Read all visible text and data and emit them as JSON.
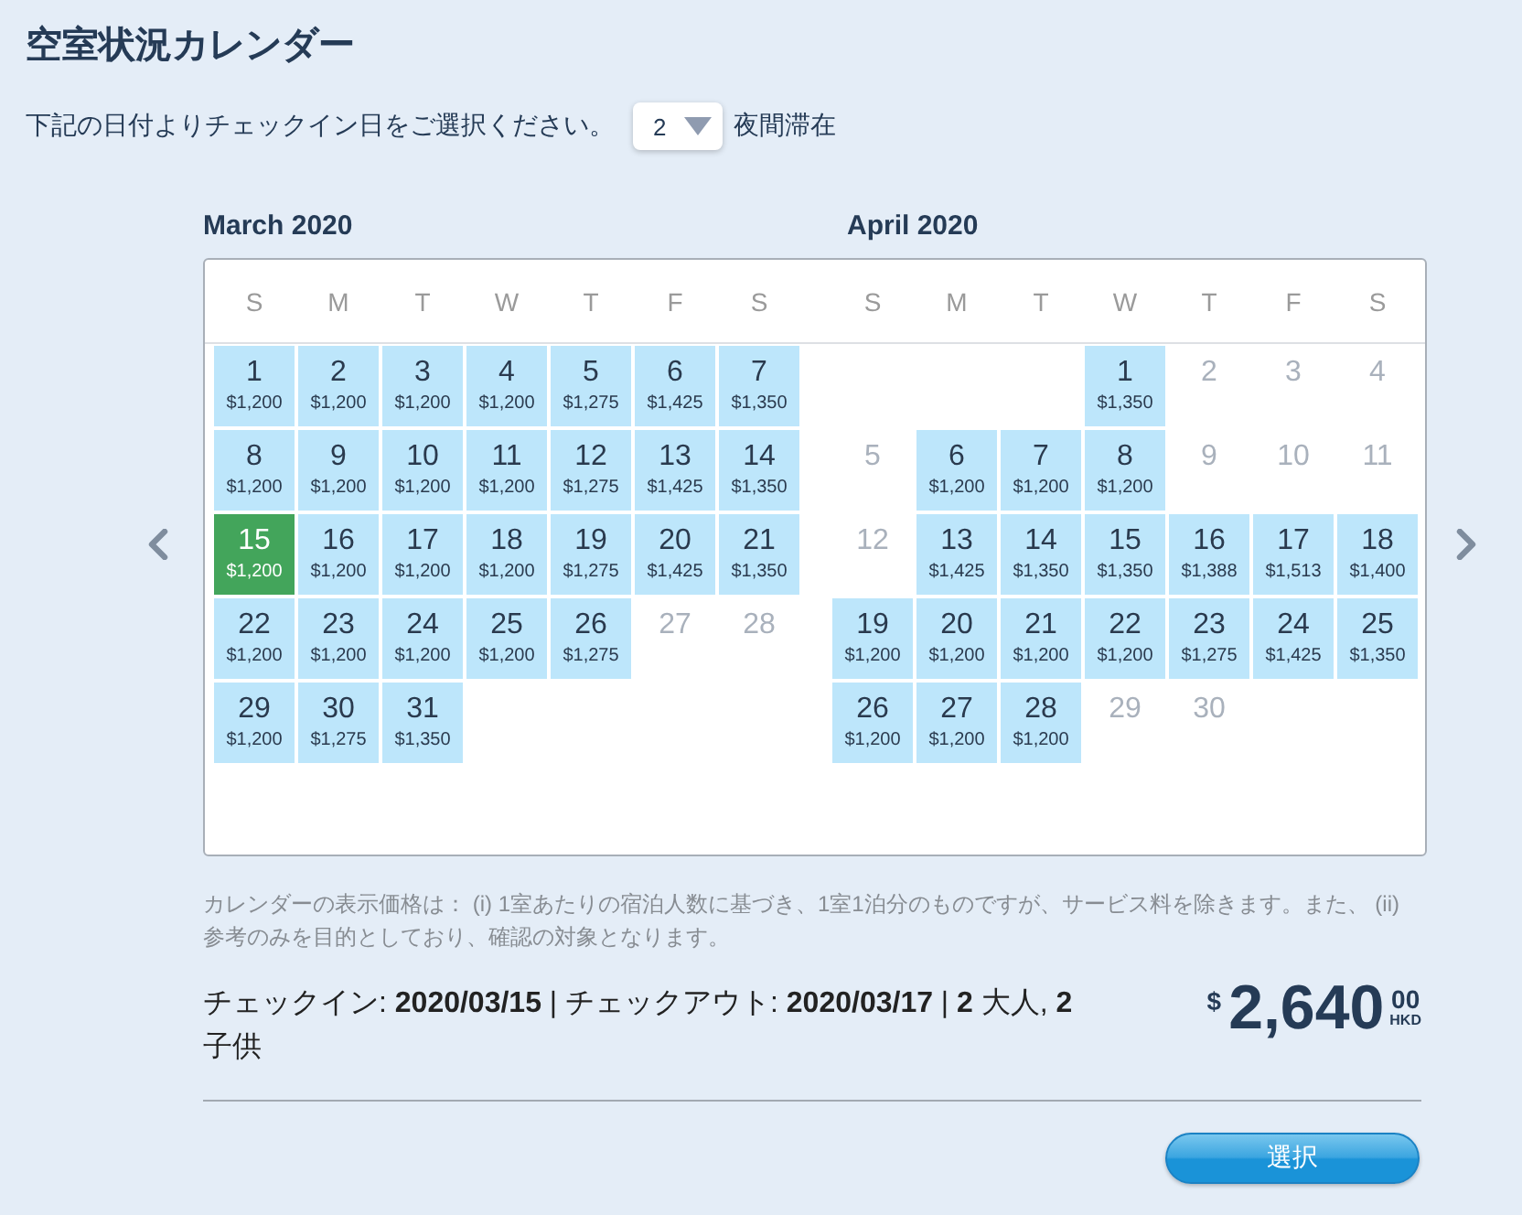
{
  "title": "空室状況カレンダー",
  "prompt": {
    "text": "下記の日付よりチェックイン日をご選択ください。",
    "nights_select": {
      "value": "2"
    },
    "suffix": "夜間滞在"
  },
  "calendar": {
    "months": [
      {
        "title": "March 2020",
        "weekdays": [
          "S",
          "M",
          "T",
          "W",
          "T",
          "F",
          "S"
        ],
        "weeks": [
          [
            {
              "day": "1",
              "price": "$1,200",
              "available": true,
              "selected": false
            },
            {
              "day": "2",
              "price": "$1,200",
              "available": true,
              "selected": false
            },
            {
              "day": "3",
              "price": "$1,200",
              "available": true,
              "selected": false
            },
            {
              "day": "4",
              "price": "$1,200",
              "available": true,
              "selected": false
            },
            {
              "day": "5",
              "price": "$1,275",
              "available": true,
              "selected": false
            },
            {
              "day": "6",
              "price": "$1,425",
              "available": true,
              "selected": false
            },
            {
              "day": "7",
              "price": "$1,350",
              "available": true,
              "selected": false
            }
          ],
          [
            {
              "day": "8",
              "price": "$1,200",
              "available": true,
              "selected": false
            },
            {
              "day": "9",
              "price": "$1,200",
              "available": true,
              "selected": false
            },
            {
              "day": "10",
              "price": "$1,200",
              "available": true,
              "selected": false
            },
            {
              "day": "11",
              "price": "$1,200",
              "available": true,
              "selected": false
            },
            {
              "day": "12",
              "price": "$1,275",
              "available": true,
              "selected": false
            },
            {
              "day": "13",
              "price": "$1,425",
              "available": true,
              "selected": false
            },
            {
              "day": "14",
              "price": "$1,350",
              "available": true,
              "selected": false
            }
          ],
          [
            {
              "day": "15",
              "price": "$1,200",
              "available": true,
              "selected": true
            },
            {
              "day": "16",
              "price": "$1,200",
              "available": true,
              "selected": false
            },
            {
              "day": "17",
              "price": "$1,200",
              "available": true,
              "selected": false
            },
            {
              "day": "18",
              "price": "$1,200",
              "available": true,
              "selected": false
            },
            {
              "day": "19",
              "price": "$1,275",
              "available": true,
              "selected": false
            },
            {
              "day": "20",
              "price": "$1,425",
              "available": true,
              "selected": false
            },
            {
              "day": "21",
              "price": "$1,350",
              "available": true,
              "selected": false
            }
          ],
          [
            {
              "day": "22",
              "price": "$1,200",
              "available": true,
              "selected": false
            },
            {
              "day": "23",
              "price": "$1,200",
              "available": true,
              "selected": false
            },
            {
              "day": "24",
              "price": "$1,200",
              "available": true,
              "selected": false
            },
            {
              "day": "25",
              "price": "$1,200",
              "available": true,
              "selected": false
            },
            {
              "day": "26",
              "price": "$1,275",
              "available": true,
              "selected": false
            },
            {
              "day": "27",
              "available": false,
              "selected": false
            },
            {
              "day": "28",
              "available": false,
              "selected": false
            }
          ],
          [
            {
              "day": "29",
              "price": "$1,200",
              "available": true,
              "selected": false
            },
            {
              "day": "30",
              "price": "$1,275",
              "available": true,
              "selected": false
            },
            {
              "day": "31",
              "price": "$1,350",
              "available": true,
              "selected": false
            }
          ]
        ]
      },
      {
        "title": "April 2020",
        "weekdays": [
          "S",
          "M",
          "T",
          "W",
          "T",
          "F",
          "S"
        ],
        "weeks": [
          [
            {
              "day": "1",
              "price": "$1,350",
              "available": true,
              "selected": false
            },
            {
              "day": "2",
              "available": false,
              "selected": false
            },
            {
              "day": "3",
              "available": false,
              "selected": false
            },
            {
              "day": "4",
              "available": false,
              "selected": false
            }
          ],
          [
            {
              "day": "5",
              "available": false,
              "selected": false
            },
            {
              "day": "6",
              "price": "$1,200",
              "available": true,
              "selected": false
            },
            {
              "day": "7",
              "price": "$1,200",
              "available": true,
              "selected": false
            },
            {
              "day": "8",
              "price": "$1,200",
              "available": true,
              "selected": false
            },
            {
              "day": "9",
              "available": false,
              "selected": false
            },
            {
              "day": "10",
              "available": false,
              "selected": false
            },
            {
              "day": "11",
              "available": false,
              "selected": false
            }
          ],
          [
            {
              "day": "12",
              "available": false,
              "selected": false
            },
            {
              "day": "13",
              "price": "$1,425",
              "available": true,
              "selected": false
            },
            {
              "day": "14",
              "price": "$1,350",
              "available": true,
              "selected": false
            },
            {
              "day": "15",
              "price": "$1,350",
              "available": true,
              "selected": false
            },
            {
              "day": "16",
              "price": "$1,388",
              "available": true,
              "selected": false
            },
            {
              "day": "17",
              "price": "$1,513",
              "available": true,
              "selected": false
            },
            {
              "day": "18",
              "price": "$1,400",
              "available": true,
              "selected": false
            }
          ],
          [
            {
              "day": "19",
              "price": "$1,200",
              "available": true,
              "selected": false
            },
            {
              "day": "20",
              "price": "$1,200",
              "available": true,
              "selected": false
            },
            {
              "day": "21",
              "price": "$1,200",
              "available": true,
              "selected": false
            },
            {
              "day": "22",
              "price": "$1,200",
              "available": true,
              "selected": false
            },
            {
              "day": "23",
              "price": "$1,275",
              "available": true,
              "selected": false
            },
            {
              "day": "24",
              "price": "$1,425",
              "available": true,
              "selected": false
            },
            {
              "day": "25",
              "price": "$1,350",
              "available": true,
              "selected": false
            }
          ],
          [
            {
              "day": "26",
              "price": "$1,200",
              "available": true,
              "selected": false
            },
            {
              "day": "27",
              "price": "$1,200",
              "available": true,
              "selected": false
            },
            {
              "day": "28",
              "price": "$1,200",
              "available": true,
              "selected": false
            },
            {
              "day": "29",
              "available": false,
              "selected": false
            },
            {
              "day": "30",
              "available": false,
              "selected": false
            }
          ]
        ]
      }
    ]
  },
  "note": "カレンダーの表示価格は： (i) 1室あたりの宿泊人数に基づき、1室1泊分のものですが、サービス料を除きます。また、 (ii) 参考のみを目的としており、確認の対象となります。",
  "summary": "チェックイン: **2020/03/15** | チェックアウト: **2020/03/17** | **2** 大人, **2** 子供",
  "price": {
    "currency_symbol": "$",
    "amount": "2,640",
    "cents": "00",
    "currency": "HKD"
  },
  "select_button": {
    "label": "選択"
  }
}
